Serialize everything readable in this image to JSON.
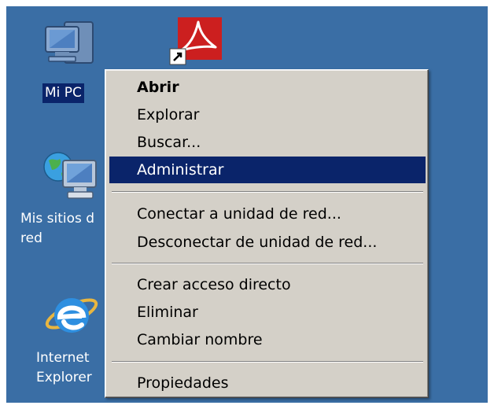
{
  "desktop": {
    "background": "#3a6ea5",
    "icons": [
      {
        "name": "my-computer",
        "label": "Mi PC",
        "selected": true
      },
      {
        "name": "adobe-reader-shortcut",
        "label": ""
      },
      {
        "name": "network-places",
        "label": "Mis sitios d\nred"
      },
      {
        "name": "internet-explorer",
        "label": "Internet\nExplorer"
      }
    ]
  },
  "context_menu": {
    "items": [
      {
        "label": "Abrir",
        "bold": true
      },
      {
        "label": "Explorar"
      },
      {
        "label": "Buscar..."
      },
      {
        "label": "Administrar",
        "highlighted": true
      },
      {
        "label": "Conectar a unidad de red..."
      },
      {
        "label": "Desconectar de unidad de red..."
      },
      {
        "label": "Crear acceso directo"
      },
      {
        "label": "Eliminar"
      },
      {
        "label": "Cambiar nombre"
      },
      {
        "label": "Propiedades"
      }
    ],
    "highlight_color": "#0a246a",
    "background": "#d4d0c8"
  }
}
